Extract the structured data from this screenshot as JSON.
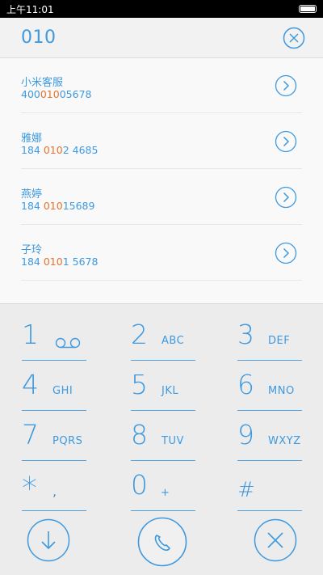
{
  "status_bar": {
    "time": "上午11:01",
    "icons": [
      "battery-icon"
    ]
  },
  "search": {
    "query": "010",
    "clear_icon": "close-circle-icon"
  },
  "colors": {
    "accent": "#3d99e0",
    "highlight": "#e8722c",
    "background": "#ececec"
  },
  "results": [
    {
      "name": "小米客服",
      "number_parts": [
        {
          "text": "400",
          "hl": false
        },
        {
          "text": "010",
          "hl": true
        },
        {
          "text": "05678",
          "hl": false
        }
      ]
    },
    {
      "name": "雅娜",
      "number_parts": [
        {
          "text": "184 ",
          "hl": false
        },
        {
          "text": "010",
          "hl": true
        },
        {
          "text": "2 4685",
          "hl": false
        }
      ]
    },
    {
      "name": "燕婷",
      "number_parts": [
        {
          "text": "184 ",
          "hl": false
        },
        {
          "text": "010",
          "hl": true
        },
        {
          "text": "15689",
          "hl": false
        }
      ]
    },
    {
      "name": "子玲",
      "number_parts": [
        {
          "text": "184 ",
          "hl": false
        },
        {
          "text": "010",
          "hl": true
        },
        {
          "text": "1 5678",
          "hl": false
        }
      ]
    }
  ],
  "keypad": [
    {
      "digit": "1",
      "letters": "",
      "icon": "voicemail-icon"
    },
    {
      "digit": "2",
      "letters": "ABC"
    },
    {
      "digit": "3",
      "letters": "DEF"
    },
    {
      "digit": "4",
      "letters": "GHI"
    },
    {
      "digit": "5",
      "letters": "JKL"
    },
    {
      "digit": "6",
      "letters": "MNO"
    },
    {
      "digit": "7",
      "letters": "PQRS"
    },
    {
      "digit": "8",
      "letters": "TUV"
    },
    {
      "digit": "9",
      "letters": "WXYZ"
    },
    {
      "digit": "*",
      "letters": ","
    },
    {
      "digit": "0",
      "letters": "+"
    },
    {
      "digit": "#",
      "letters": ""
    }
  ],
  "actions": {
    "hide_icon": "arrow-down-circle-icon",
    "call_icon": "phone-icon",
    "delete_icon": "close-circle-icon"
  }
}
